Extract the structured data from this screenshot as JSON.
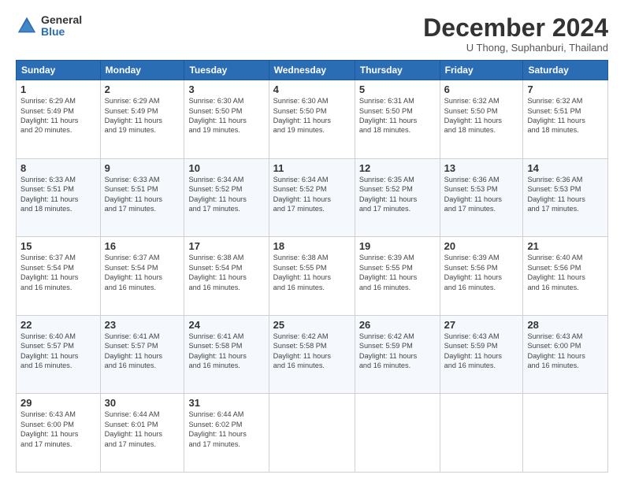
{
  "logo": {
    "general": "General",
    "blue": "Blue"
  },
  "header": {
    "month": "December 2024",
    "location": "U Thong, Suphanburi, Thailand"
  },
  "weekdays": [
    "Sunday",
    "Monday",
    "Tuesday",
    "Wednesday",
    "Thursday",
    "Friday",
    "Saturday"
  ],
  "weeks": [
    [
      {
        "day": "1",
        "info": "Sunrise: 6:29 AM\nSunset: 5:49 PM\nDaylight: 11 hours\nand 20 minutes."
      },
      {
        "day": "2",
        "info": "Sunrise: 6:29 AM\nSunset: 5:49 PM\nDaylight: 11 hours\nand 19 minutes."
      },
      {
        "day": "3",
        "info": "Sunrise: 6:30 AM\nSunset: 5:50 PM\nDaylight: 11 hours\nand 19 minutes."
      },
      {
        "day": "4",
        "info": "Sunrise: 6:30 AM\nSunset: 5:50 PM\nDaylight: 11 hours\nand 19 minutes."
      },
      {
        "day": "5",
        "info": "Sunrise: 6:31 AM\nSunset: 5:50 PM\nDaylight: 11 hours\nand 18 minutes."
      },
      {
        "day": "6",
        "info": "Sunrise: 6:32 AM\nSunset: 5:50 PM\nDaylight: 11 hours\nand 18 minutes."
      },
      {
        "day": "7",
        "info": "Sunrise: 6:32 AM\nSunset: 5:51 PM\nDaylight: 11 hours\nand 18 minutes."
      }
    ],
    [
      {
        "day": "8",
        "info": "Sunrise: 6:33 AM\nSunset: 5:51 PM\nDaylight: 11 hours\nand 18 minutes."
      },
      {
        "day": "9",
        "info": "Sunrise: 6:33 AM\nSunset: 5:51 PM\nDaylight: 11 hours\nand 17 minutes."
      },
      {
        "day": "10",
        "info": "Sunrise: 6:34 AM\nSunset: 5:52 PM\nDaylight: 11 hours\nand 17 minutes."
      },
      {
        "day": "11",
        "info": "Sunrise: 6:34 AM\nSunset: 5:52 PM\nDaylight: 11 hours\nand 17 minutes."
      },
      {
        "day": "12",
        "info": "Sunrise: 6:35 AM\nSunset: 5:52 PM\nDaylight: 11 hours\nand 17 minutes."
      },
      {
        "day": "13",
        "info": "Sunrise: 6:36 AM\nSunset: 5:53 PM\nDaylight: 11 hours\nand 17 minutes."
      },
      {
        "day": "14",
        "info": "Sunrise: 6:36 AM\nSunset: 5:53 PM\nDaylight: 11 hours\nand 17 minutes."
      }
    ],
    [
      {
        "day": "15",
        "info": "Sunrise: 6:37 AM\nSunset: 5:54 PM\nDaylight: 11 hours\nand 16 minutes."
      },
      {
        "day": "16",
        "info": "Sunrise: 6:37 AM\nSunset: 5:54 PM\nDaylight: 11 hours\nand 16 minutes."
      },
      {
        "day": "17",
        "info": "Sunrise: 6:38 AM\nSunset: 5:54 PM\nDaylight: 11 hours\nand 16 minutes."
      },
      {
        "day": "18",
        "info": "Sunrise: 6:38 AM\nSunset: 5:55 PM\nDaylight: 11 hours\nand 16 minutes."
      },
      {
        "day": "19",
        "info": "Sunrise: 6:39 AM\nSunset: 5:55 PM\nDaylight: 11 hours\nand 16 minutes."
      },
      {
        "day": "20",
        "info": "Sunrise: 6:39 AM\nSunset: 5:56 PM\nDaylight: 11 hours\nand 16 minutes."
      },
      {
        "day": "21",
        "info": "Sunrise: 6:40 AM\nSunset: 5:56 PM\nDaylight: 11 hours\nand 16 minutes."
      }
    ],
    [
      {
        "day": "22",
        "info": "Sunrise: 6:40 AM\nSunset: 5:57 PM\nDaylight: 11 hours\nand 16 minutes."
      },
      {
        "day": "23",
        "info": "Sunrise: 6:41 AM\nSunset: 5:57 PM\nDaylight: 11 hours\nand 16 minutes."
      },
      {
        "day": "24",
        "info": "Sunrise: 6:41 AM\nSunset: 5:58 PM\nDaylight: 11 hours\nand 16 minutes."
      },
      {
        "day": "25",
        "info": "Sunrise: 6:42 AM\nSunset: 5:58 PM\nDaylight: 11 hours\nand 16 minutes."
      },
      {
        "day": "26",
        "info": "Sunrise: 6:42 AM\nSunset: 5:59 PM\nDaylight: 11 hours\nand 16 minutes."
      },
      {
        "day": "27",
        "info": "Sunrise: 6:43 AM\nSunset: 5:59 PM\nDaylight: 11 hours\nand 16 minutes."
      },
      {
        "day": "28",
        "info": "Sunrise: 6:43 AM\nSunset: 6:00 PM\nDaylight: 11 hours\nand 16 minutes."
      }
    ],
    [
      {
        "day": "29",
        "info": "Sunrise: 6:43 AM\nSunset: 6:00 PM\nDaylight: 11 hours\nand 17 minutes."
      },
      {
        "day": "30",
        "info": "Sunrise: 6:44 AM\nSunset: 6:01 PM\nDaylight: 11 hours\nand 17 minutes."
      },
      {
        "day": "31",
        "info": "Sunrise: 6:44 AM\nSunset: 6:02 PM\nDaylight: 11 hours\nand 17 minutes."
      },
      null,
      null,
      null,
      null
    ]
  ]
}
